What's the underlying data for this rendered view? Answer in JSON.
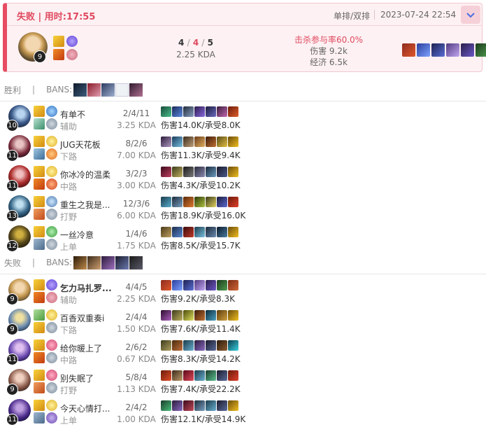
{
  "summary": {
    "result_title": "失败 | 用时:17:55",
    "queue": "单排/双排",
    "date": "2023-07-24 22:54",
    "champion_level": "9",
    "kills": "4",
    "deaths": "4",
    "assists": "5",
    "slash": "/",
    "kda": "2.25 KDA",
    "kill_participation": "击杀参与率60.0%",
    "damage": "伤害 9.2k",
    "gold": "经济 6.5k"
  },
  "teams": [
    {
      "label": "胜利",
      "bans_label": "BANS:",
      "players": [
        {
          "name": "有单不",
          "position": "辅助",
          "level": "10",
          "kda_line": "2/4/11",
          "kda": "3.25 KDA",
          "damage": "伤害14.0K/承受8.0K"
        },
        {
          "name": "JUG天花板",
          "position": "下路",
          "level": "11",
          "kda_line": "8/2/6",
          "kda": "7.00 KDA",
          "damage": "伤害11.3K/承受9.4K"
        },
        {
          "name": "你冰冷的温柔",
          "position": "中路",
          "level": "11",
          "kda_line": "3/2/3",
          "kda": "3.00 KDA",
          "damage": "伤害4.3K/承受10.2K"
        },
        {
          "name": "重生之我是...",
          "position": "打野",
          "level": "13",
          "kda_line": "12/3/6",
          "kda": "6.00 KDA",
          "damage": "伤害18.9K/承受16.0K"
        },
        {
          "name": "一丝冷意",
          "position": "上单",
          "level": "12",
          "kda_line": "1/4/6",
          "kda": "1.75 KDA",
          "damage": "伤害8.5K/承受15.7K"
        }
      ]
    },
    {
      "label": "失败",
      "bans_label": "BANS:",
      "players": [
        {
          "name": "乞力马扎罗...",
          "position": "辅助",
          "level": "9",
          "kda_line": "4/4/5",
          "kda": "2.25 KDA",
          "damage": "伤害9.2K/承受8.3K"
        },
        {
          "name": "百香双重奏i",
          "position": "下路",
          "level": "9",
          "kda_line": "2/4/4",
          "kda": "1.50 KDA",
          "damage": "伤害7.6K/承受11.4K"
        },
        {
          "name": "给你暖上了",
          "position": "中路",
          "level": "11",
          "kda_line": "2/6/2",
          "kda": "0.67 KDA",
          "damage": "伤害8.3K/承受14.2K"
        },
        {
          "name": "别失眠了",
          "position": "打野",
          "level": "9",
          "kda_line": "5/8/4",
          "kda": "1.13 KDA",
          "damage": "伤害7.4K/承受22.2K"
        },
        {
          "name": "今天心情打...",
          "position": "上单",
          "level": "11",
          "kda_line": "2/4/2",
          "kda": "1.00 KDA",
          "damage": "伤害12.1K/承受14.9K"
        }
      ]
    }
  ],
  "colors": {
    "loss_accent": "#e74c62",
    "loss_bg": "#fdf1f3"
  }
}
